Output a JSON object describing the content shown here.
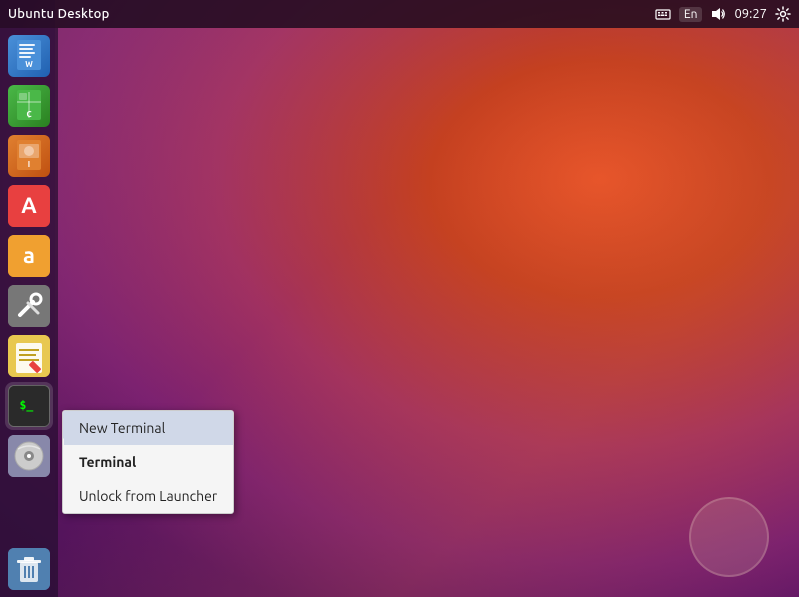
{
  "desktop": {
    "title": "Ubuntu Desktop"
  },
  "top_panel": {
    "title": "Ubuntu Desktop",
    "time": "09:27",
    "language": "En",
    "icons": {
      "keyboard": "⌨",
      "volume": "🔊",
      "settings": "⚙"
    }
  },
  "launcher": {
    "items": [
      {
        "id": "writer",
        "label": "LibreOffice Writer",
        "icon": "writer"
      },
      {
        "id": "calc",
        "label": "LibreOffice Calc",
        "icon": "calc"
      },
      {
        "id": "impress",
        "label": "LibreOffice Impress",
        "icon": "impress"
      },
      {
        "id": "appstore",
        "label": "Ubuntu Software Center",
        "icon": "appstore"
      },
      {
        "id": "amazon",
        "label": "Amazon",
        "icon": "amazon"
      },
      {
        "id": "system",
        "label": "System Tools",
        "icon": "system"
      },
      {
        "id": "notes",
        "label": "Notes",
        "icon": "notes"
      },
      {
        "id": "terminal",
        "label": "Terminal",
        "icon": "terminal"
      },
      {
        "id": "dvd",
        "label": "DVD Player",
        "icon": "dvd"
      },
      {
        "id": "trash",
        "label": "Trash",
        "icon": "trash"
      }
    ]
  },
  "context_menu": {
    "items": [
      {
        "id": "new-terminal",
        "label": "New Terminal",
        "style": "highlighted"
      },
      {
        "id": "terminal-label",
        "label": "Terminal",
        "style": "bold"
      },
      {
        "id": "unlock",
        "label": "Unlock from Launcher",
        "style": "normal"
      }
    ]
  }
}
